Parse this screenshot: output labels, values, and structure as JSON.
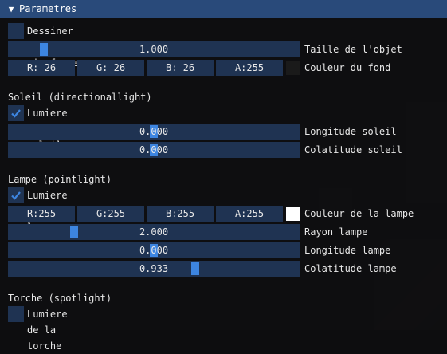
{
  "window": {
    "title": "Parametres"
  },
  "wireframe": {
    "label": "Dessiner en wireframe",
    "checked": false
  },
  "object_size": {
    "value": "1.000",
    "level": 0.108,
    "label": "Taille de l'objet"
  },
  "background_color": {
    "r": "R: 26",
    "g": "G: 26",
    "b": "B: 26",
    "a": "A:255",
    "label": "Couleur du fond",
    "swatch": "#1a1a1a"
  },
  "sun": {
    "heading": "Soleil (directionallight)",
    "enable_label": "Lumiere du soleil",
    "enabled": true,
    "longitude": {
      "value": "0.000",
      "level": 0.5,
      "label": "Longitude soleil"
    },
    "colatitude": {
      "value": "0.000",
      "level": 0.5,
      "label": "Colatitude soleil"
    }
  },
  "lamp": {
    "heading": "Lampe (pointlight)",
    "enable_label": "Lumiere de la lampe",
    "enabled": true,
    "color": {
      "r": "R:255",
      "g": "G:255",
      "b": "B:255",
      "a": "A:255",
      "label": "Couleur de la lampe",
      "swatch": "#ffffff"
    },
    "radius": {
      "value": "2.000",
      "level": 0.215,
      "label": "Rayon lampe"
    },
    "longitude": {
      "value": "0.000",
      "level": 0.5,
      "label": "Longitude lampe"
    },
    "colatitude": {
      "value": "0.933",
      "level": 0.648,
      "label": "Colatitude lampe"
    }
  },
  "torch": {
    "heading": "Torche (spotlight)",
    "enable_label": "Lumiere de la torche",
    "enabled": false
  },
  "colors": {
    "title_bar": "#294a7a",
    "frame": "#1f3352",
    "grab": "#3d85e0",
    "check": "#3d85e0"
  }
}
